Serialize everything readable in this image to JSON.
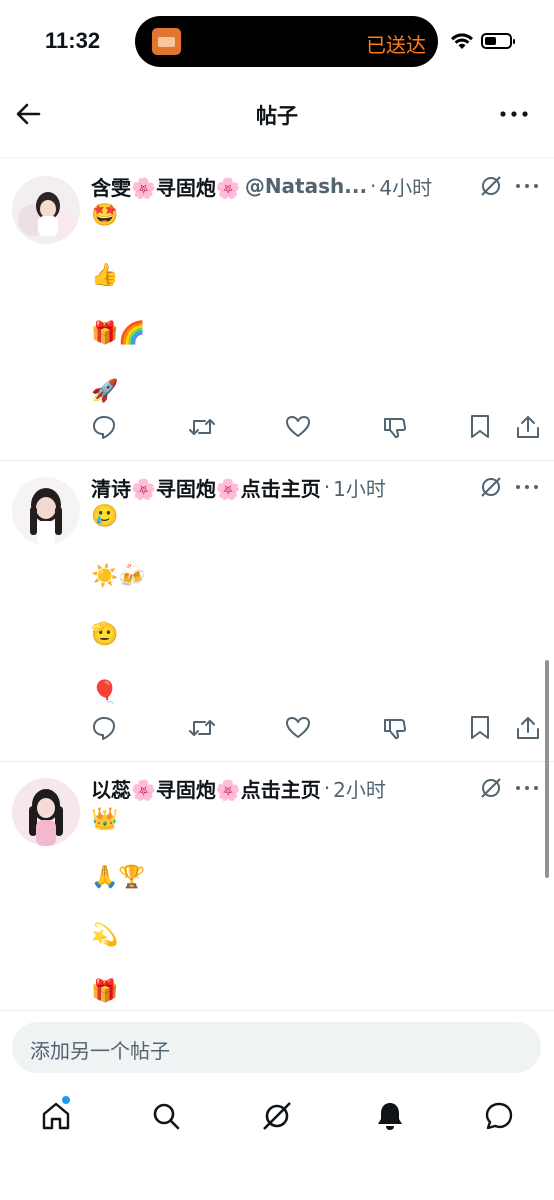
{
  "status_bar": {
    "time": "11:32",
    "island_text": "已送达"
  },
  "header": {
    "title": "帖子"
  },
  "posts": [
    {
      "name": "含雯🌸寻固炮🌸",
      "handle": "@Natash...",
      "time": "4小时",
      "lines": [
        "🤩",
        "👍",
        "🎁🌈",
        "🚀"
      ]
    },
    {
      "name": "清诗🌸寻固炮🌸点击主页",
      "handle": "",
      "time": "1小时",
      "lines": [
        "🥲",
        "☀️🍻",
        "🫡",
        "🎈"
      ]
    },
    {
      "name": "以蕊🌸寻固炮🌸点击主页",
      "handle": "",
      "time": "2小时",
      "lines": [
        "👑",
        "🙏🏆",
        "💫",
        "🎁"
      ]
    }
  ],
  "compose": {
    "placeholder": "添加另一个帖子"
  },
  "tabs": [
    "home-icon",
    "search-icon",
    "grok-icon",
    "bell-icon",
    "messages-icon"
  ],
  "colors": {
    "text": "#0f1419",
    "secondary": "#536471",
    "accent": "#1d9bf0",
    "island_orange": "#ff7a1a"
  }
}
